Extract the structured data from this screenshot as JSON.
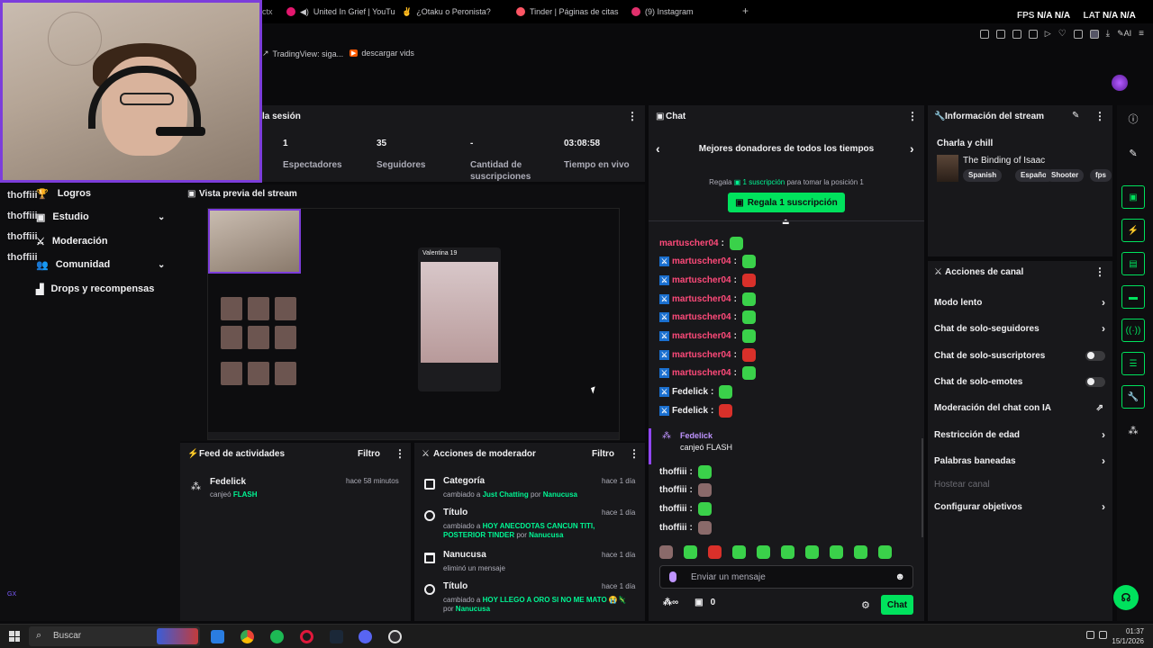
{
  "browser": {
    "tabs": [
      {
        "label": "ctx",
        "color": "#7c3ddb"
      },
      {
        "label": "United In Grief | YouTu",
        "color": "#e3176e"
      },
      {
        "label": "¿Otaku o Peronista?",
        "color": "#f2c200"
      },
      {
        "label": "Tinder | Páginas de citas",
        "color": "#fd5564"
      },
      {
        "label": "(9) Instagram",
        "color": "#e1306c"
      }
    ],
    "new_tab": "+",
    "fps_label": "FPS",
    "fps_value_1": "N/A",
    "fps_value_2": "N/A",
    "lat_label": "LAT",
    "lat_value_1": "N/A",
    "lat_value_2": "N/A",
    "ai_label": "AI",
    "bookmarks": [
      {
        "label": "TradingView: siga...",
        "icon": "chart-icon"
      },
      {
        "label": "descargar vids",
        "icon": "play-icon"
      }
    ]
  },
  "webcam_overlay": {
    "names": [
      "thoffiii",
      "thoffiii",
      "thoffiii",
      "thoffiii"
    ]
  },
  "left_nav": {
    "items": [
      {
        "label": "Logros",
        "chevron": false
      },
      {
        "label": "Estudio",
        "chevron": true
      },
      {
        "label": "Moderación",
        "chevron": false
      },
      {
        "label": "Comunidad",
        "chevron": true
      },
      {
        "label": "Drops y recompensas",
        "chevron": false
      }
    ],
    "gx_label": "GX"
  },
  "session": {
    "title": "la sesión",
    "stats": [
      {
        "value": "1",
        "label": "Espectadores"
      },
      {
        "value": "35",
        "label": "Seguidores"
      },
      {
        "value": "-",
        "label": "Cantidad de suscripciones"
      },
      {
        "value": "03:08:58",
        "label": "Tiempo en vivo"
      }
    ]
  },
  "preview": {
    "title": "Vista previa del stream",
    "card_name": "Valentina 19"
  },
  "activity": {
    "title": "Feed de actividades",
    "filter": "Filtro",
    "items": [
      {
        "user": "Fedelick",
        "action": "canjeó",
        "item": "FLASH",
        "time": "hace 58 minutos"
      }
    ]
  },
  "mod_actions": {
    "title": "Acciones de moderador",
    "filter": "Filtro",
    "items": [
      {
        "title": "Categoría",
        "time": "hace 1 día",
        "desc_prefix": "cambiado a",
        "highlight": "Just Chatting",
        "by": "por",
        "user": "Nanucusa"
      },
      {
        "title": "Título",
        "time": "hace 1 día",
        "desc_prefix": "cambiado a",
        "highlight": "HOY ANECDOTAS CANCUN TITI, POSTERIOR TINDER",
        "by": "por",
        "user": "Nanucusa"
      },
      {
        "title": "Nanucusa",
        "time": "hace 1 día",
        "desc_prefix": "eliminó un mensaje",
        "highlight": "",
        "by": "",
        "user": ""
      },
      {
        "title": "Título",
        "time": "hace 1 día",
        "desc_prefix": "cambiado a",
        "highlight": "HOY LLEGO A ORO SI NO ME MATO 😭🦎",
        "by": "por",
        "user": "Nanucusa"
      }
    ]
  },
  "chat": {
    "title": "Chat",
    "donors_title": "Mejores donadores de todos los tiempos",
    "gift_hint_prefix": "Regala",
    "gift_hint_link": "1 suscripción",
    "gift_hint_suffix": "para tomar la posición 1",
    "gift_button": "Regala 1 suscripción",
    "messages": [
      {
        "user": "martuscher04",
        "color": "#ff4a7a",
        "emote": "em-g",
        "mod": false
      },
      {
        "user": "martuscher04",
        "color": "#ff4a7a",
        "emote": "em-g",
        "mod": true
      },
      {
        "user": "martuscher04",
        "color": "#ff4a7a",
        "emote": "em-r",
        "mod": true
      },
      {
        "user": "martuscher04",
        "color": "#ff4a7a",
        "emote": "em-g",
        "mod": true
      },
      {
        "user": "martuscher04",
        "color": "#ff4a7a",
        "emote": "em-g",
        "mod": true
      },
      {
        "user": "martuscher04",
        "color": "#ff4a7a",
        "emote": "em-g",
        "mod": true
      },
      {
        "user": "martuscher04",
        "color": "#ff4a7a",
        "emote": "em-r",
        "mod": true
      },
      {
        "user": "martuscher04",
        "color": "#ff4a7a",
        "emote": "em-g",
        "mod": true
      },
      {
        "user": "Fedelick",
        "color": "#efeff1",
        "emote": "em-g",
        "mod": true
      },
      {
        "user": "Fedelick",
        "color": "#efeff1",
        "emote": "em-r",
        "mod": true
      }
    ],
    "redeem": {
      "user": "Fedelick",
      "text": "canjeó FLASH"
    },
    "messages_after": [
      {
        "user": "thoffiii",
        "emote": "em-g"
      },
      {
        "user": "thoffiii",
        "emote": "em-p"
      },
      {
        "user": "thoffiii",
        "emote": "em-g"
      },
      {
        "user": "thoffiii",
        "emote": "em-p"
      }
    ],
    "input_placeholder": "Enviar un mensaje",
    "points": "0",
    "send_button": "Chat"
  },
  "stream_info": {
    "title": "Información del stream",
    "stream_title": "Charla y chill",
    "game": "The Binding of Isaac",
    "tags": [
      "Spanish",
      "Español",
      "Shooter",
      "fps"
    ]
  },
  "channel_actions": {
    "title": "Acciones de canal",
    "rows": [
      {
        "label": "Modo lento",
        "control": "chevron"
      },
      {
        "label": "Chat de solo-seguidores",
        "control": "chevron"
      },
      {
        "label": "Chat de solo-suscriptores",
        "control": "toggle"
      },
      {
        "label": "Chat de solo-emotes",
        "control": "toggle"
      },
      {
        "label": "Moderación del chat con IA",
        "control": "link"
      },
      {
        "label": "Restricción de edad",
        "control": "chevron"
      },
      {
        "label": "Palabras baneadas",
        "control": "chevron"
      },
      {
        "label": "Hostear canal",
        "control": "none"
      },
      {
        "label": "Configurar objetivos",
        "control": "chevron"
      }
    ]
  },
  "taskbar": {
    "search": "Buscar",
    "time": "01:37",
    "date": "15/1/2026"
  },
  "colors": {
    "accent_green": "#00e25d",
    "accent_purple": "#9146ff",
    "panel_bg": "#18181b"
  }
}
